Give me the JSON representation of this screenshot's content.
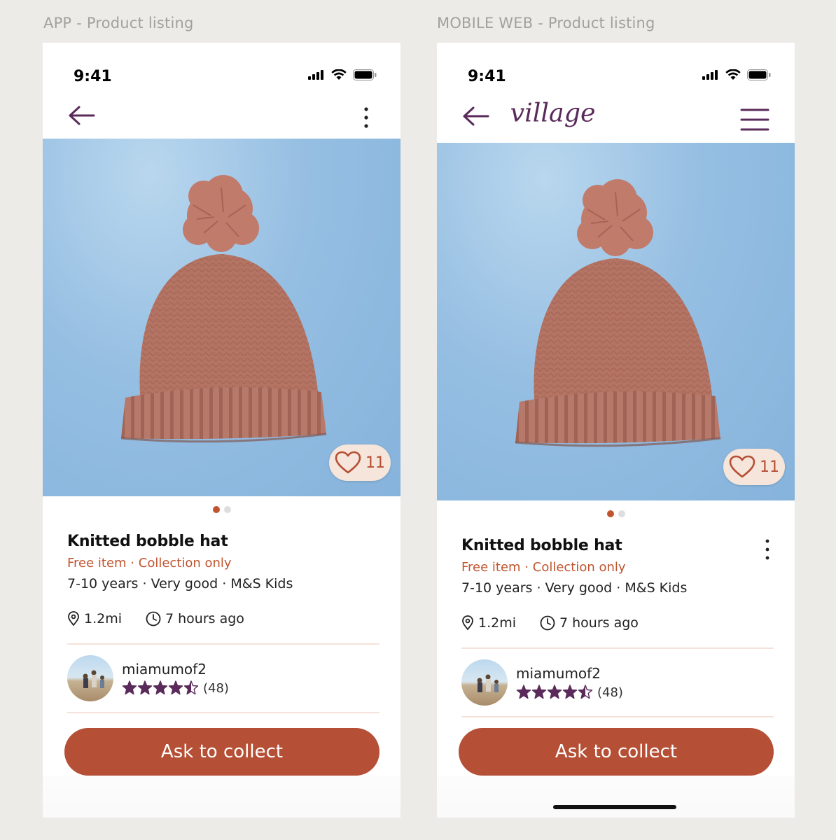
{
  "labels": {
    "app": "APP - Product listing",
    "web": "MOBILE WEB - Product listing"
  },
  "status": {
    "time": "9:41"
  },
  "brand": {
    "logo_text": "village"
  },
  "listing": {
    "likes": "11",
    "title": "Knitted bobble hat",
    "subtitle": "Free item · Collection only",
    "meta": "7-10 years · Very good · M&S Kids",
    "distance": "1.2mi",
    "posted": "7 hours ago",
    "seller_name": "miamumof2",
    "rating_value": 4.5,
    "rating_count": "(48)",
    "cta_label": "Ask to collect"
  },
  "colors": {
    "accent": "#b54f35",
    "brand_purple": "#5a2a5a",
    "photo_bg": "#95bee2"
  }
}
